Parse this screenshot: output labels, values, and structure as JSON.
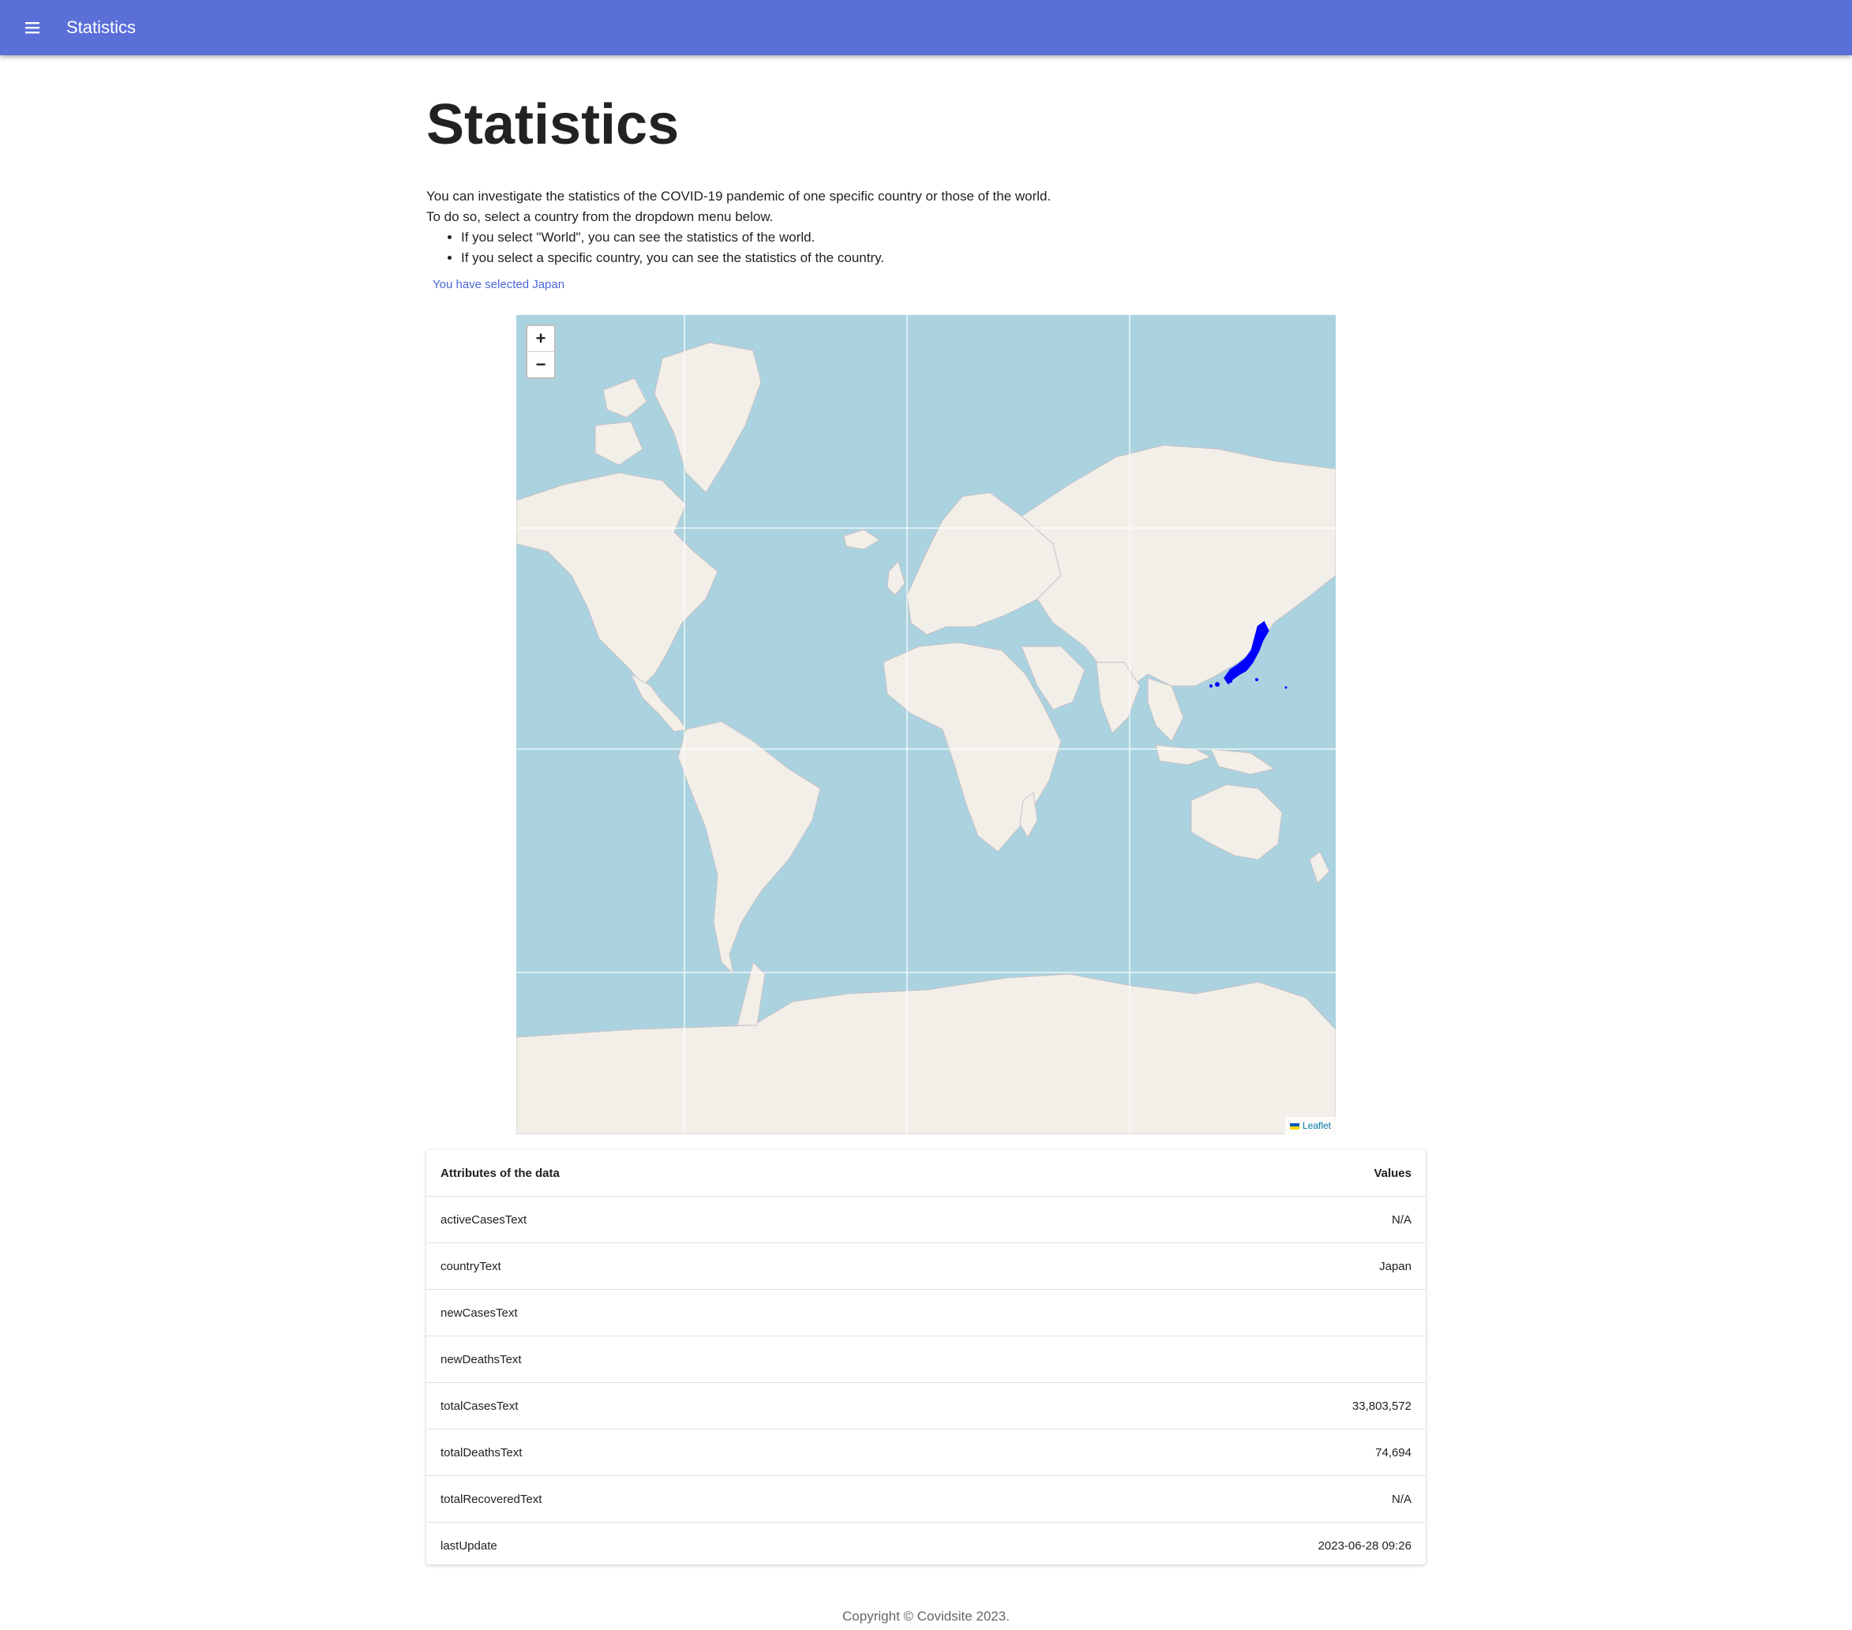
{
  "appbar": {
    "title": "Statistics"
  },
  "page": {
    "heading": "Statistics",
    "intro_line1": "You can investigate the statistics of the COVID-19 pandemic of one specific country or those of the world.",
    "intro_line2": "To do so, select a country from the dropdown menu below.",
    "bullets": [
      "If you select \"World\", you can see the statistics of the world.",
      "If you select a specific country, you can see the statistics of the country."
    ],
    "selected_note": "You have selected Japan"
  },
  "map": {
    "zoom_in": "+",
    "zoom_out": "−",
    "attribution": "Leaflet",
    "highlight_color": "#0000ff",
    "water_color": "#aad3df",
    "land_color": "#f2efe9"
  },
  "table": {
    "headers": {
      "attribute": "Attributes of the data",
      "value": "Values"
    },
    "rows": [
      {
        "attribute": "activeCasesText",
        "value": "N/A"
      },
      {
        "attribute": "countryText",
        "value": "Japan"
      },
      {
        "attribute": "newCasesText",
        "value": ""
      },
      {
        "attribute": "newDeathsText",
        "value": ""
      },
      {
        "attribute": "totalCasesText",
        "value": "33,803,572"
      },
      {
        "attribute": "totalDeathsText",
        "value": "74,694"
      },
      {
        "attribute": "totalRecoveredText",
        "value": "N/A"
      },
      {
        "attribute": "lastUpdate",
        "value": "2023-06-28 09:26"
      }
    ]
  },
  "footer": {
    "copyright": "Copyright © Covidsite 2023."
  }
}
